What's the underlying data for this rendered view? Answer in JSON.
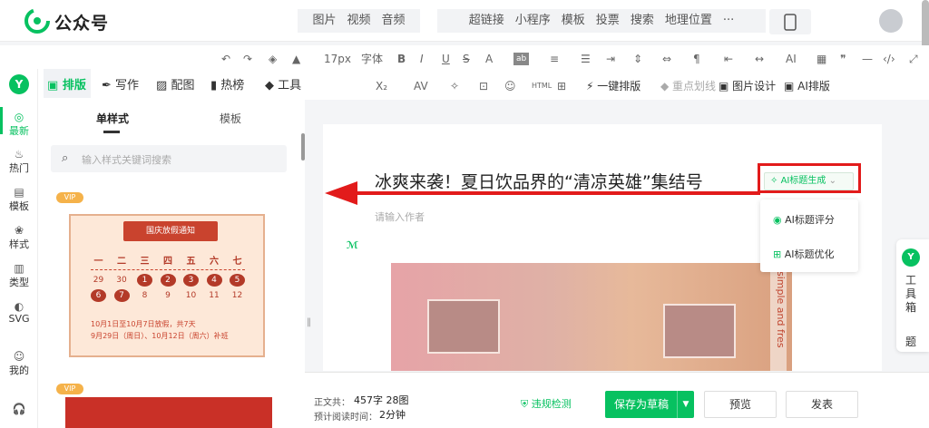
{
  "app": {
    "brand": "公众号"
  },
  "insert_toolbar": {
    "group1": [
      "图片",
      "视频",
      "音频"
    ],
    "group2": [
      "超链接",
      "小程序",
      "模板",
      "投票",
      "搜索",
      "地理位置"
    ],
    "more": "···"
  },
  "format_toolbar": {
    "font_size": "17px",
    "font_family": "字体",
    "bold": "B",
    "italic": "I",
    "underline": "U",
    "strike": "S",
    "color": "A",
    "row2": [
      "X₂",
      "AV",
      "一键排版",
      "重点划线",
      "图片设计",
      "AI排版"
    ]
  },
  "left_rail": [
    {
      "label": "最新",
      "icon": "speech-bubble-icon"
    },
    {
      "label": "热门",
      "icon": "flame-icon"
    },
    {
      "label": "模板",
      "icon": "template-icon"
    },
    {
      "label": "样式",
      "icon": "style-icon"
    },
    {
      "label": "类型",
      "icon": "type-icon"
    },
    {
      "label": "SVG",
      "icon": "svg-icon"
    },
    {
      "label": "我的",
      "icon": "user-icon"
    }
  ],
  "panel_tabs": [
    "排版",
    "写作",
    "配图",
    "热榜",
    "工具"
  ],
  "subtabs": [
    "单样式",
    "模板"
  ],
  "search": {
    "placeholder": "输入样式关键词搜索"
  },
  "style_card": {
    "vip": "VIP",
    "title": "国庆放假通知",
    "weekdays": [
      "一",
      "二",
      "三",
      "四",
      "五",
      "六",
      "七"
    ],
    "row1": [
      "29",
      "30",
      "1",
      "2",
      "3",
      "4",
      "5"
    ],
    "row2": [
      "6",
      "7",
      "8",
      "9",
      "10",
      "11",
      "12"
    ],
    "note1": "10月1日至10月7日放假，共7天",
    "note2": "9月29日（周日）、10月12日（周六）补班"
  },
  "article": {
    "title": "冰爽来袭！夏日饮品界的“清凉英雄”集结号",
    "author_placeholder": "请输入作者",
    "image_text": "simple and fres"
  },
  "ai_title": {
    "button": "AI标题生成",
    "menu": [
      "AI标题评分",
      "AI标题优化"
    ]
  },
  "toolbox": {
    "label": [
      "工",
      "具",
      "箱"
    ],
    "extra": "题"
  },
  "bottom": {
    "word_count_label": "正文共：",
    "word_count": "457字 28图",
    "read_time_label": "预计阅读时间：",
    "read_time": "2分钟",
    "check": "违规检测",
    "save": "保存为草稿",
    "preview": "预览",
    "publish": "发表"
  },
  "colors": {
    "accent": "#07c160",
    "highlight": "#e21b1b"
  }
}
